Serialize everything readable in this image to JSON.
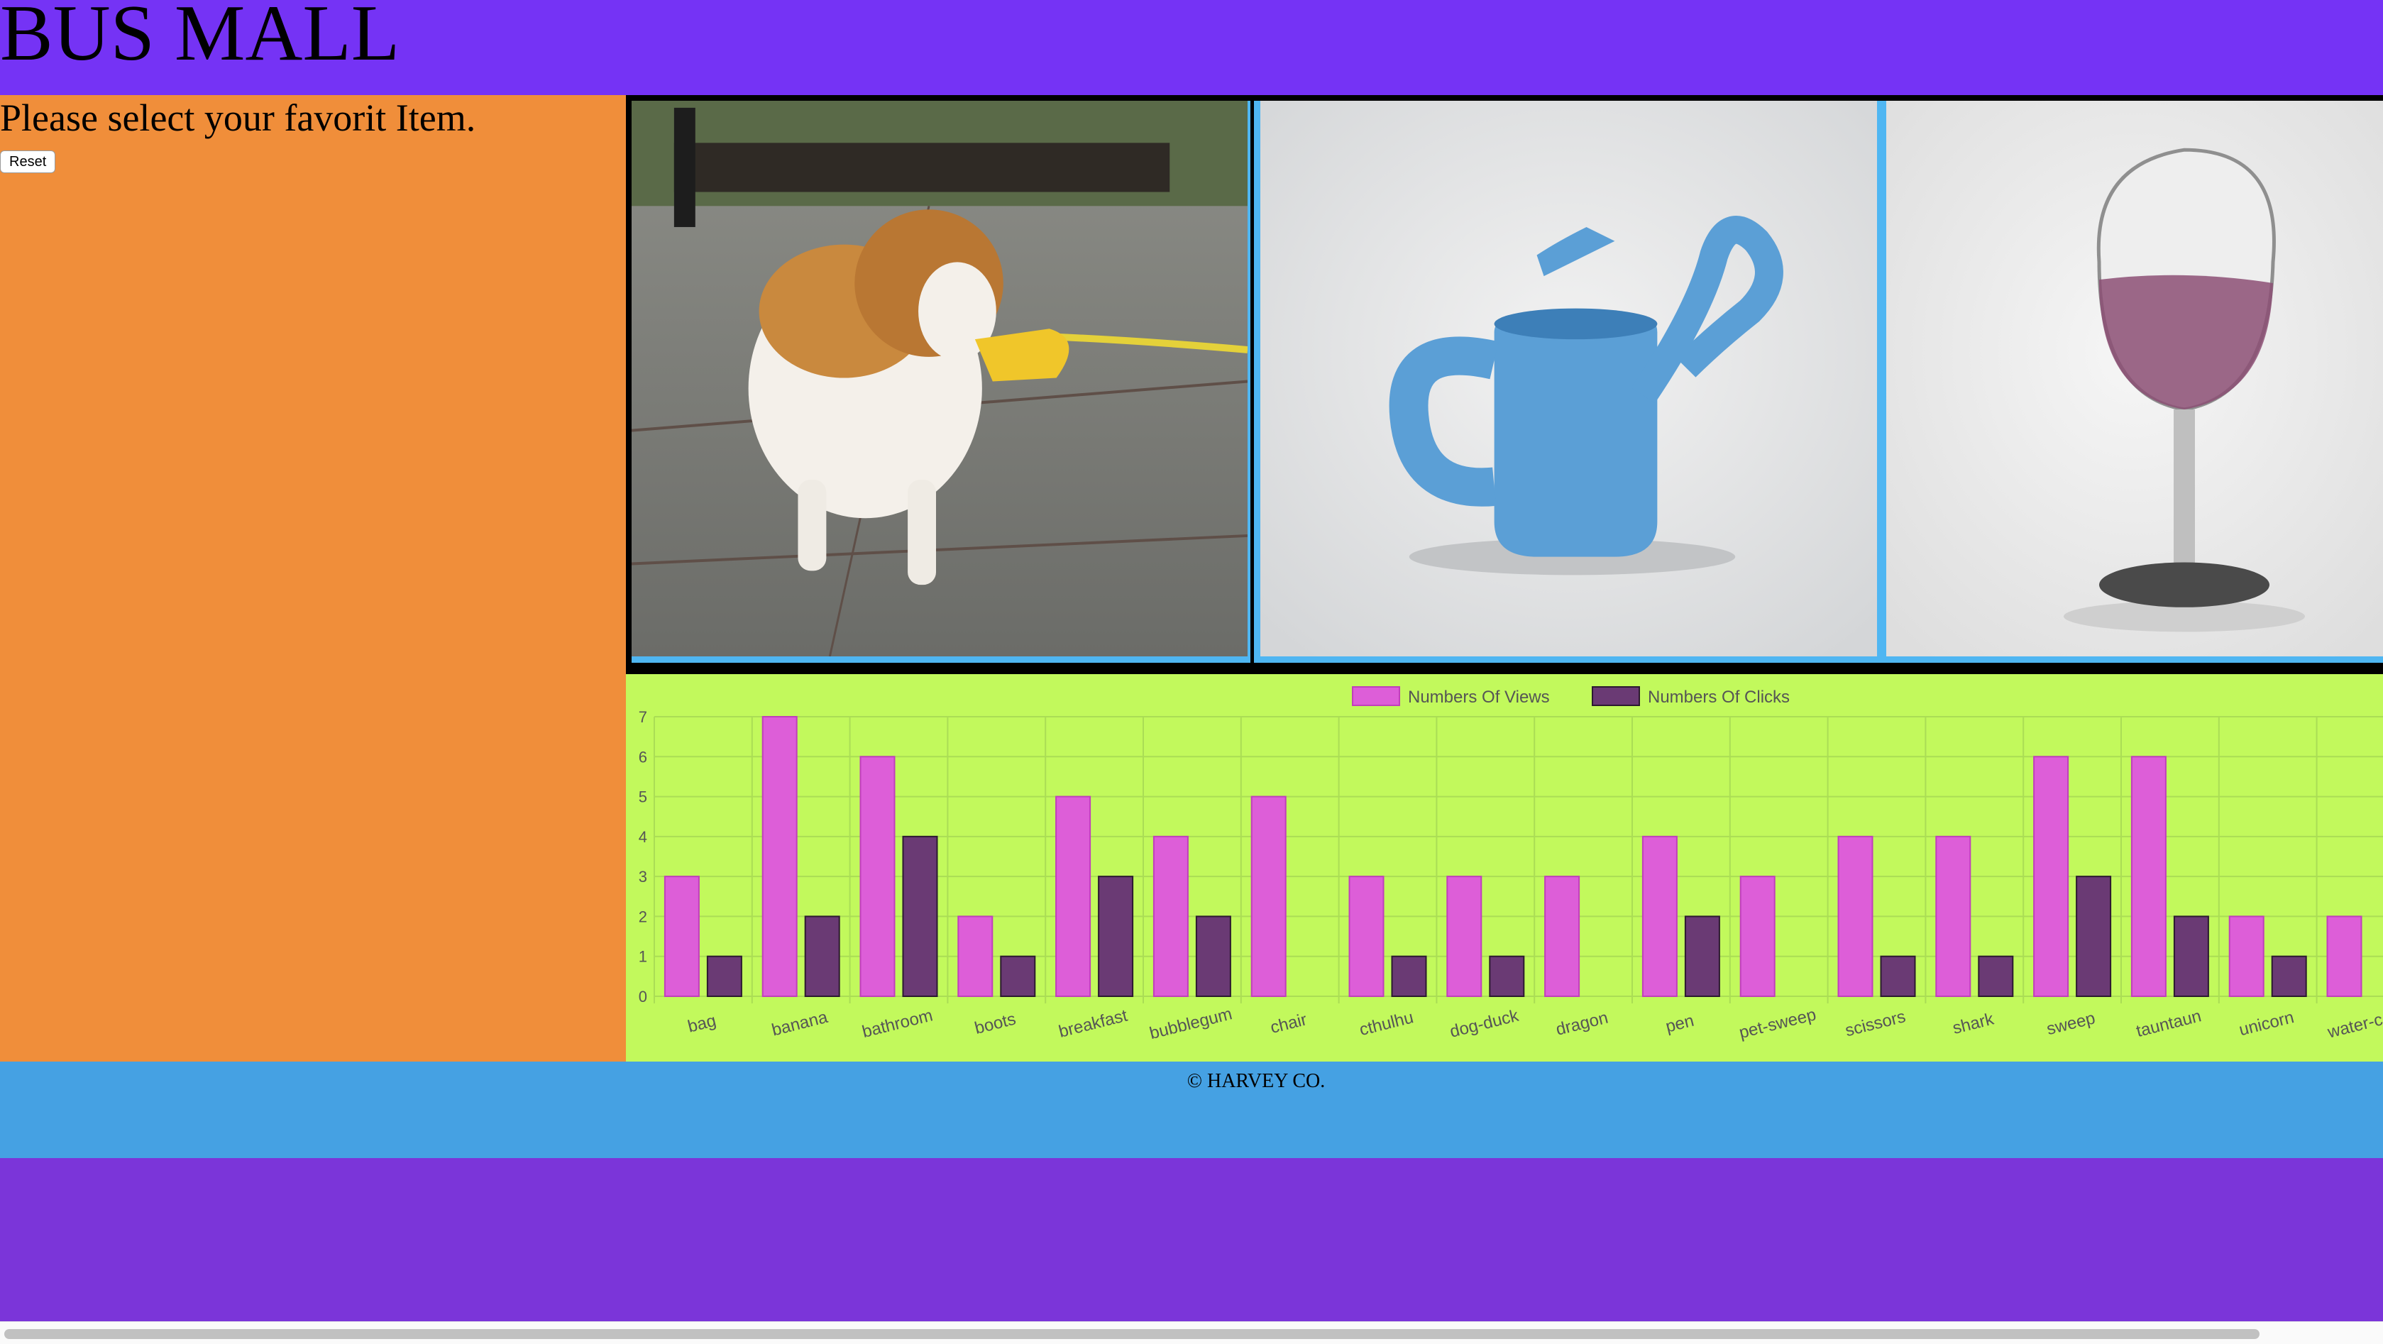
{
  "header": {
    "title": "BUS MALL"
  },
  "sidebar": {
    "prompt": "Please select your favorit Item.",
    "reset_label": "Reset"
  },
  "products": {
    "items": [
      {
        "name": "dog-duck",
        "icon": "dog-with-duck-muzzle-photo"
      },
      {
        "name": "water-can",
        "icon": "watering-can-photo"
      },
      {
        "name": "wine-glass",
        "icon": "wine-glass-photo"
      }
    ]
  },
  "chart_data": {
    "type": "bar",
    "categories": [
      "bag",
      "banana",
      "bathroom",
      "boots",
      "breakfast",
      "bubblegum",
      "chair",
      "cthulhu",
      "dog-duck",
      "dragon",
      "pen",
      "pet-sweep",
      "scissors",
      "shark",
      "sweep",
      "tauntaun",
      "unicorn",
      "water-can"
    ],
    "series": [
      {
        "name": "Numbers Of Views",
        "color": "#dd5ed8",
        "values": [
          3,
          7,
          6,
          2,
          5,
          4,
          5,
          3,
          3,
          3,
          4,
          3,
          4,
          4,
          6,
          6,
          2,
          2
        ]
      },
      {
        "name": "Numbers Of Clicks",
        "color": "#6a3a74",
        "values": [
          1,
          2,
          4,
          1,
          3,
          2,
          0,
          1,
          1,
          0,
          2,
          0,
          1,
          1,
          3,
          2,
          1,
          0
        ]
      }
    ],
    "yticks": [
      "0",
      "1",
      "2",
      "3",
      "4",
      "5",
      "6",
      "7"
    ],
    "ylim": [
      0,
      7
    ],
    "grid": true,
    "legend": "top-center"
  },
  "footer": {
    "copyright": "© HARVEY CO."
  }
}
